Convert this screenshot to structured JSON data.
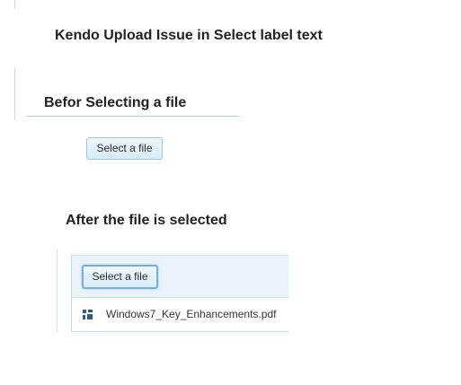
{
  "title": "Kendo Upload Issue in Select label text",
  "before_section": {
    "heading": "Befor Selecting a file",
    "select_button_label": "Select a file"
  },
  "after_section": {
    "heading": "After the file is selected",
    "select_button_label": "Select a file",
    "files": [
      {
        "name": "Windows7_Key_Enhancements.pdf",
        "icon": "file-type-icon"
      }
    ]
  },
  "colors": {
    "accent_border": "#9ec6e0",
    "header_bg": "#e8f2f9",
    "focus_border": "#79aed6"
  }
}
